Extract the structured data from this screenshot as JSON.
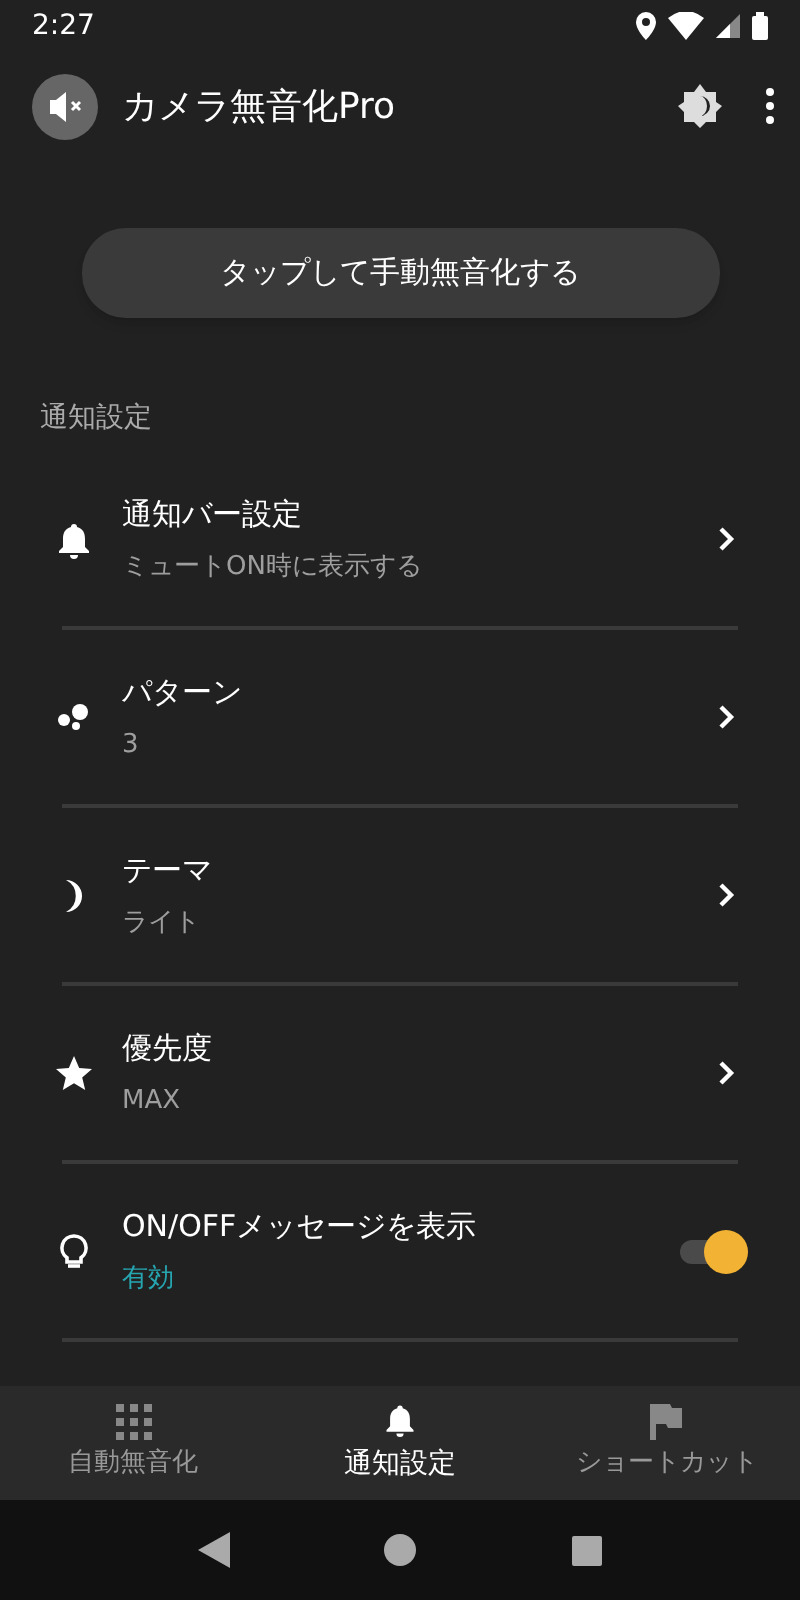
{
  "status_bar": {
    "time": "2:27"
  },
  "app_bar": {
    "title": "カメラ無音化Pro"
  },
  "main_button": {
    "label": "タップして手動無音化する"
  },
  "section": {
    "title": "通知設定"
  },
  "settings": [
    {
      "kind": "link",
      "title": "通知バー設定",
      "subtitle": "ミュートON時に表示する"
    },
    {
      "kind": "link",
      "title": "パターン",
      "subtitle": "3"
    },
    {
      "kind": "link",
      "title": "テーマ",
      "subtitle": "ライト"
    },
    {
      "kind": "link",
      "title": "優先度",
      "subtitle": "MAX"
    },
    {
      "kind": "toggle",
      "title": "ON/OFFメッセージを表示",
      "subtitle": "有効",
      "on": true
    }
  ],
  "bottom_nav": [
    {
      "label": "自動無音化",
      "selected": false
    },
    {
      "label": "通知設定",
      "selected": true
    },
    {
      "label": "ショートカット",
      "selected": false
    }
  ]
}
